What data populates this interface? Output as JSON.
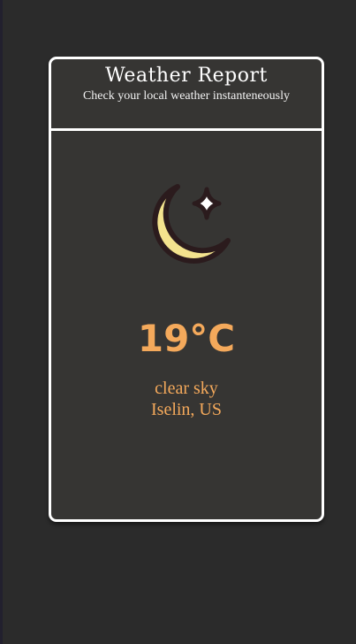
{
  "header": {
    "title": "Weather Report",
    "subtitle": "Check your local weather instanteneously"
  },
  "weather": {
    "icon": "crescent-moon-with-star-icon",
    "temperature": "19°C",
    "description": "clear sky",
    "location": "Iselin, US"
  },
  "colors": {
    "background": "#2b2b2b",
    "card": "#363533",
    "border": "#ffffff",
    "accent": "#f4a95b",
    "moon": "#f3e38e",
    "outline": "#2b1b1d"
  }
}
